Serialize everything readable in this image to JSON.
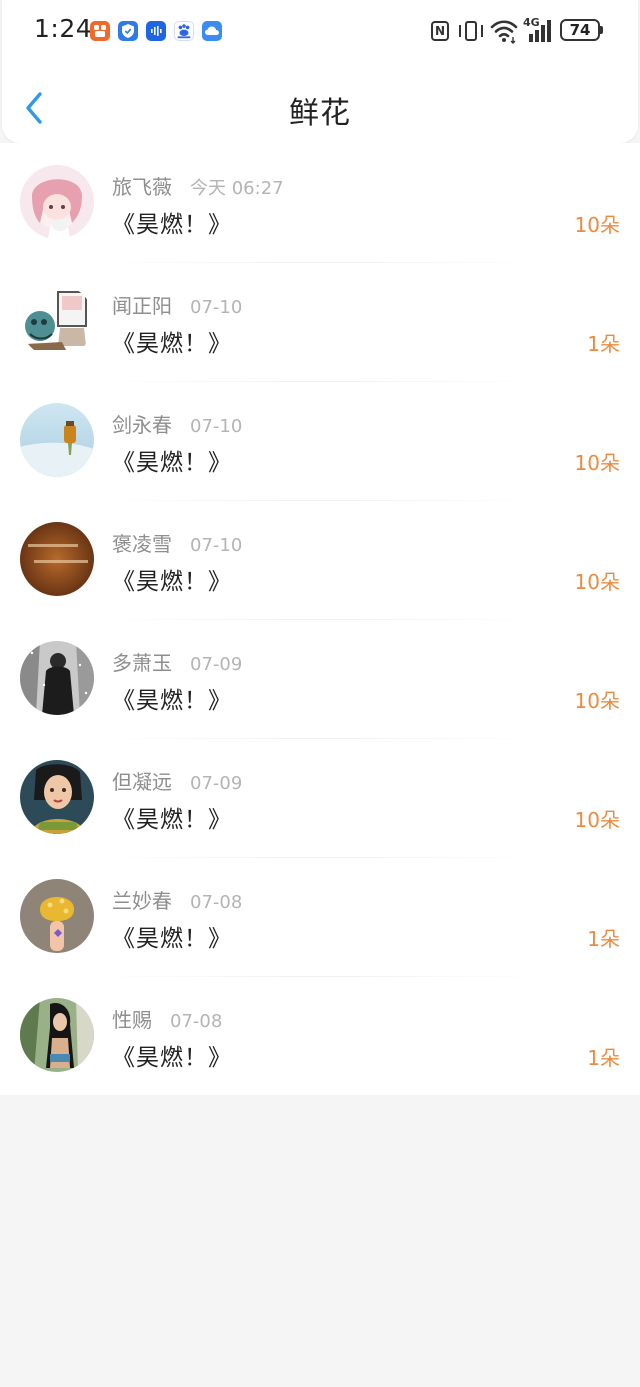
{
  "status_bar": {
    "time": "1:24",
    "network": "4G",
    "battery": "74"
  },
  "header": {
    "title": "鲜花"
  },
  "colors": {
    "accent_blue": "#2f98e8",
    "count_orange": "#ec8b3f",
    "background": "#f6f5f5"
  },
  "items": [
    {
      "name": "旅飞薇",
      "time": "今天 06:27",
      "book": "《昊燃！》",
      "count": "10朵"
    },
    {
      "name": "闻正阳",
      "time": "07-10",
      "book": "《昊燃！》",
      "count": "1朵"
    },
    {
      "name": "剑永春",
      "time": "07-10",
      "book": "《昊燃！》",
      "count": "10朵"
    },
    {
      "name": "褒凌雪",
      "time": "07-10",
      "book": "《昊燃！》",
      "count": "10朵"
    },
    {
      "name": "多萧玉",
      "time": "07-09",
      "book": "《昊燃！》",
      "count": "10朵"
    },
    {
      "name": "但凝远",
      "time": "07-09",
      "book": "《昊燃！》",
      "count": "10朵"
    },
    {
      "name": "兰妙春",
      "time": "07-08",
      "book": "《昊燃！》",
      "count": "1朵"
    },
    {
      "name": "性赐",
      "time": "07-08",
      "book": "《昊燃！》",
      "count": "1朵"
    }
  ]
}
